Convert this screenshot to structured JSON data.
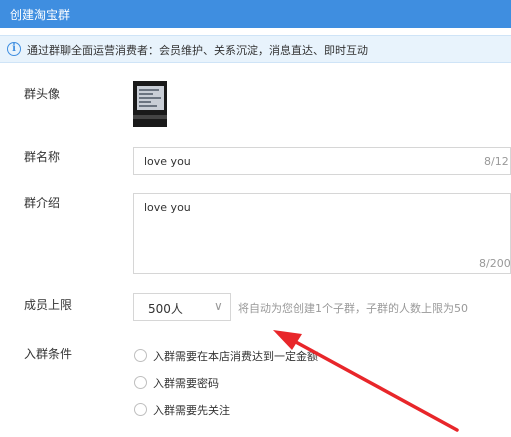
{
  "window": {
    "title": "创建淘宝群"
  },
  "notice": {
    "icon": "info-icon",
    "text": "通过群聊全面运营消费者：会员维护、关系沉淀，消息直达、即时互动"
  },
  "form": {
    "avatar_label": "群头像",
    "name_label": "群名称",
    "name_value": "love you",
    "name_counter": "8/12",
    "intro_label": "群介绍",
    "intro_value": "love you",
    "intro_counter": "8/200",
    "limit_label": "成员上限",
    "limit_value": "500人",
    "limit_hint": "将自动为您创建1个子群，子群的人数上限为50",
    "join_label": "入群条件",
    "join_options": [
      "入群需要在本店消费达到一定金额",
      "入群需要密码",
      "入群需要先关注"
    ]
  },
  "colors": {
    "header": "#3f8ee0",
    "notice_bg": "#e8f3fc",
    "annotation_arrow": "#e8262a"
  }
}
